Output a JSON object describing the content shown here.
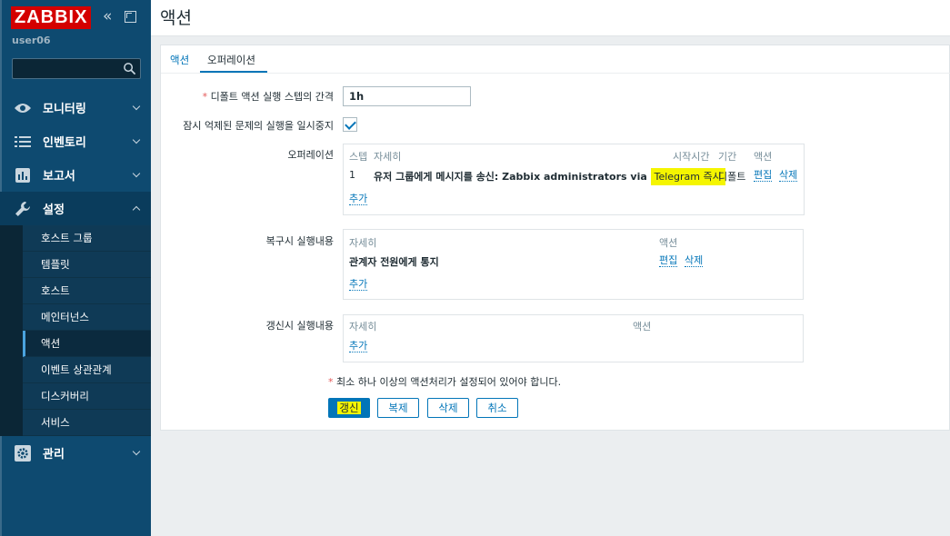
{
  "app": {
    "logo": "ZABBIX",
    "user": "user06"
  },
  "sidebar": {
    "menu": [
      {
        "label": "모니터링",
        "icon": "eye-icon"
      },
      {
        "label": "인벤토리",
        "icon": "list-icon"
      },
      {
        "label": "보고서",
        "icon": "bar-chart-icon"
      },
      {
        "label": "설정",
        "icon": "wrench-icon"
      },
      {
        "label": "관리",
        "icon": "gear-icon"
      }
    ],
    "config_items": [
      "호스트 그룹",
      "템플릿",
      "호스트",
      "메인터넌스",
      "액션",
      "이벤트 상관관계",
      "디스커버리",
      "서비스"
    ]
  },
  "header": {
    "title": "액션"
  },
  "tabs": [
    "액션",
    "오퍼레이션"
  ],
  "form": {
    "step_duration_label": "디폴트 액션 실행 스텝의 간격",
    "step_duration_value": "1h",
    "pause_label": "잠시 억제된 문제의 실행을 일시중지",
    "operations": {
      "label": "오퍼레이션",
      "headers": {
        "steps": "스텝",
        "details": "자세히",
        "start_in": "시작시간",
        "duration": "기간",
        "action": "액션"
      },
      "row": {
        "step": "1",
        "details_prefix": "유저 그룹에게 메시지를 송신: Zabbix administrators via ",
        "details_highlight": "Telegram 즉시",
        "duration": "디폴트",
        "edit": "편집",
        "remove": "삭제"
      },
      "add": "추가"
    },
    "recovery": {
      "label": "복구시 실행내용",
      "headers": {
        "details": "자세히",
        "action": "액션"
      },
      "row": {
        "details": "관계자 전원에게 통지",
        "edit": "편집",
        "remove": "삭제"
      },
      "add": "추가"
    },
    "update": {
      "label": "갱신시 실행내용",
      "headers": {
        "details": "자세히",
        "action": "액션"
      },
      "add": "추가"
    },
    "required_note": "최소 하나 이상의 액션처리가 설정되어 있어야 합니다.",
    "buttons": {
      "update": "갱신",
      "clone": "복제",
      "delete": "삭제",
      "cancel": "취소"
    }
  },
  "colors": {
    "sidebar": "#0e4a70",
    "accent": "#0275b8",
    "highlight": "#f5f500",
    "logo": "#d40000"
  }
}
